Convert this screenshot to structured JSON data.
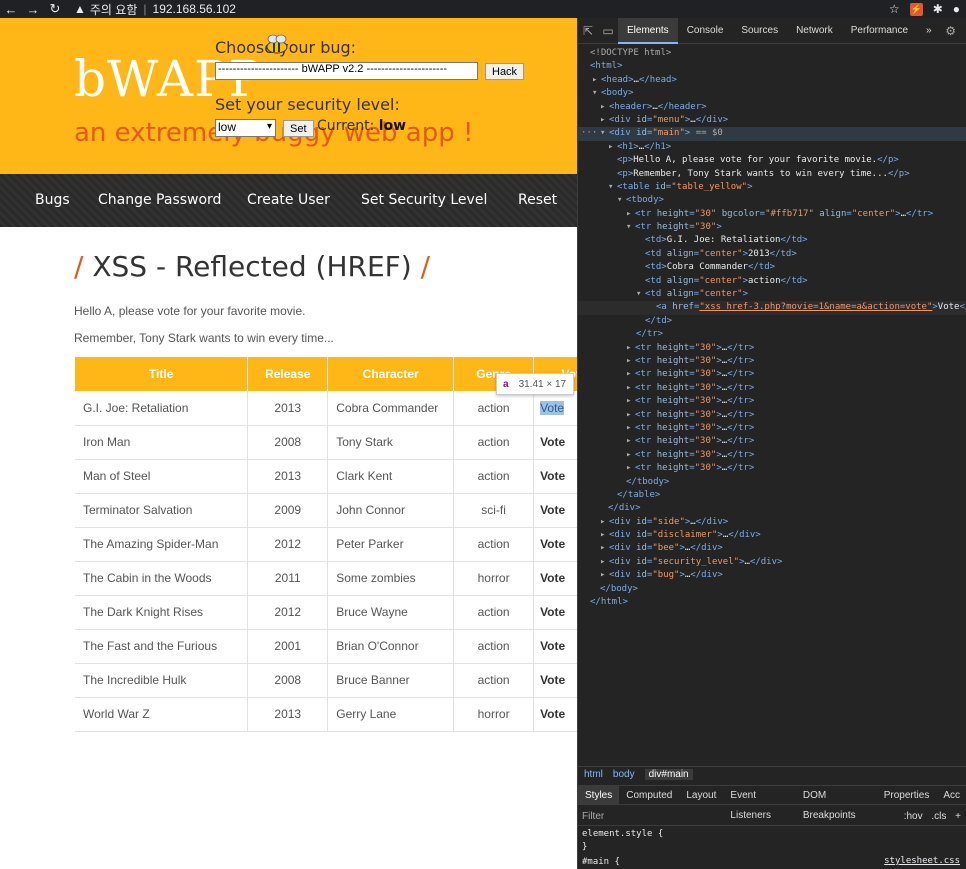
{
  "browser": {
    "security_label": "주의 요함",
    "url": "192.168.56.102"
  },
  "header": {
    "logo": "bWAPP",
    "tagline": "an extremely buggy web app !",
    "choose_label": "Choose your bug:",
    "bug_selected": "---------------------- bWAPP v2.2 ----------------------",
    "hack_label": "Hack",
    "security_label": "Set your security level:",
    "security_selected": "low",
    "set_label": "Set",
    "current_prefix": "Current:",
    "current_value": "low"
  },
  "menu": {
    "items": [
      "Bugs",
      "Change Password",
      "Create User",
      "Set Security Level",
      "Reset"
    ]
  },
  "main": {
    "title": "XSS - Reflected (HREF)",
    "greeting": "Hello A, please vote for your favorite movie.",
    "remember": "Remember, Tony Stark wants to win every time...",
    "columns": [
      "Title",
      "Release",
      "Character",
      "Genre",
      "Vote"
    ],
    "rows": [
      {
        "title": "G.I. Joe: Retaliation",
        "release": "2013",
        "character": "Cobra Commander",
        "genre": "action",
        "vote": "Vote"
      },
      {
        "title": "Iron Man",
        "release": "2008",
        "character": "Tony Stark",
        "genre": "action",
        "vote": "Vote"
      },
      {
        "title": "Man of Steel",
        "release": "2013",
        "character": "Clark Kent",
        "genre": "action",
        "vote": "Vote"
      },
      {
        "title": "Terminator Salvation",
        "release": "2009",
        "character": "John Connor",
        "genre": "sci-fi",
        "vote": "Vote"
      },
      {
        "title": "The Amazing Spider-Man",
        "release": "2012",
        "character": "Peter Parker",
        "genre": "action",
        "vote": "Vote"
      },
      {
        "title": "The Cabin in the Woods",
        "release": "2011",
        "character": "Some zombies",
        "genre": "horror",
        "vote": "Vote"
      },
      {
        "title": "The Dark Knight Rises",
        "release": "2012",
        "character": "Bruce Wayne",
        "genre": "action",
        "vote": "Vote"
      },
      {
        "title": "The Fast and the Furious",
        "release": "2001",
        "character": "Brian O'Connor",
        "genre": "action",
        "vote": "Vote"
      },
      {
        "title": "The Incredible Hulk",
        "release": "2008",
        "character": "Bruce Banner",
        "genre": "action",
        "vote": "Vote"
      },
      {
        "title": "World War Z",
        "release": "2013",
        "character": "Gerry Lane",
        "genre": "horror",
        "vote": "Vote"
      }
    ]
  },
  "tooltip": {
    "tag": "a",
    "dims": "31.41 × 17"
  },
  "devtools": {
    "tabs": [
      "Elements",
      "Console",
      "Sources",
      "Network",
      "Performance"
    ],
    "more": "»",
    "breadcrumbs": [
      "html",
      "body",
      "div#main"
    ],
    "styles_tabs": [
      "Styles",
      "Computed",
      "Layout",
      "Event Listeners",
      "DOM Breakpoints",
      "Properties",
      "Acc"
    ],
    "filter_placeholder": "Filter",
    "filter_hov": ":hov",
    "filter_cls": ".cls",
    "rule1": "element.style {",
    "rule1_close": "}",
    "rule2": "#main {",
    "stylesheet": "stylesheet.css"
  },
  "colors": {
    "brand": "#ffb717",
    "accent": "#e45a1c",
    "menu_bg": "#2c2c2c"
  }
}
